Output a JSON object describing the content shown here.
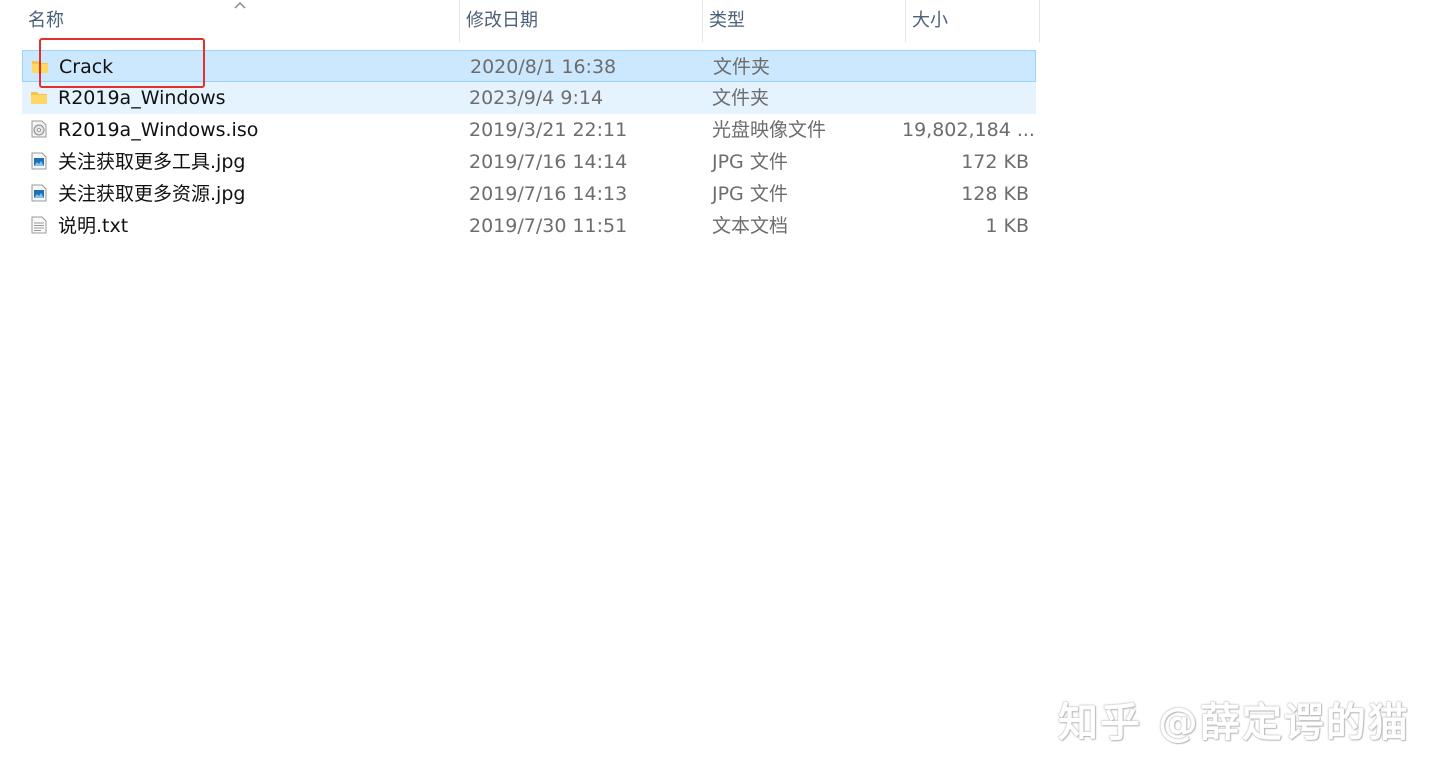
{
  "columns": {
    "name": "名称",
    "date": "修改日期",
    "type": "类型",
    "size": "大小"
  },
  "files": [
    {
      "name": "Crack",
      "date": "2020/8/1 16:38",
      "type": "文件夹",
      "size": "",
      "icon": "folder-icon"
    },
    {
      "name": "R2019a_Windows",
      "date": "2023/9/4 9:14",
      "type": "文件夹",
      "size": "",
      "icon": "folder-icon"
    },
    {
      "name": "R2019a_Windows.iso",
      "date": "2019/3/21 22:11",
      "type": "光盘映像文件",
      "size": "19,802,184 ...",
      "icon": "disc-image-icon"
    },
    {
      "name": "关注获取更多工具.jpg",
      "date": "2019/7/16 14:14",
      "type": "JPG 文件",
      "size": "172 KB",
      "icon": "image-file-icon"
    },
    {
      "name": "关注获取更多资源.jpg",
      "date": "2019/7/16 14:13",
      "type": "JPG 文件",
      "size": "128 KB",
      "icon": "image-file-icon"
    },
    {
      "name": "说明.txt",
      "date": "2019/7/30 11:51",
      "type": "文本文档",
      "size": "1 KB",
      "icon": "text-file-icon"
    }
  ],
  "watermark": "知乎 @薛定谔的猫",
  "colors": {
    "selected_bg": "#cce8ff",
    "selected_border": "#99d1ff",
    "hover_bg": "#e5f3ff",
    "highlight_box": "#e0312d",
    "folder": "#f4c44e"
  }
}
